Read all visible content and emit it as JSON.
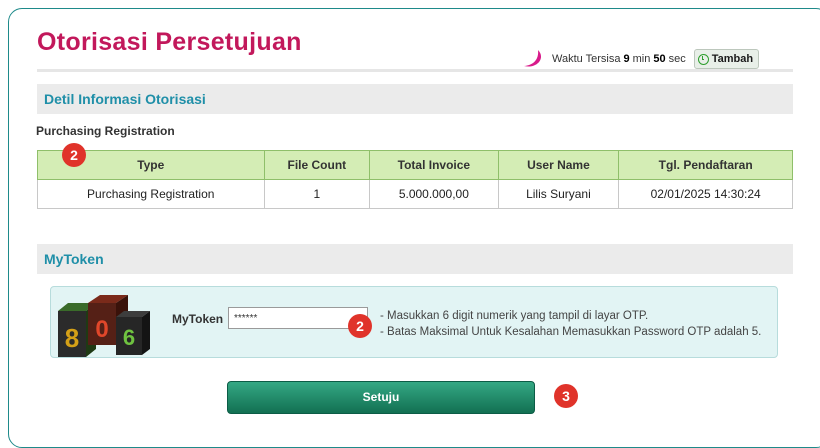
{
  "page": {
    "title": "Otorisasi Persetujuan"
  },
  "timer": {
    "label": "Waktu Tersisa",
    "minutes": "9",
    "min_label": "min",
    "seconds": "50",
    "sec_label": "sec",
    "add_button": "Tambah",
    "add_icon": "clock-icon",
    "accent_color": "#c2185b"
  },
  "detail": {
    "section_title": "Detil Informasi Otorisasi",
    "subtitle": "Purchasing Registration",
    "columns": [
      "Type",
      "File Count",
      "Total Invoice",
      "User Name",
      "Tgl. Pendaftaran"
    ],
    "rows": [
      [
        "Purchasing Registration",
        "1",
        "5.000.000,00",
        "Lilis Suryani",
        "02/01/2025 14:30:24"
      ]
    ]
  },
  "mytoken": {
    "section_title": "MyToken",
    "digits": [
      "8",
      "0",
      "6"
    ],
    "label": "MyToken",
    "value": "******",
    "notes": [
      "- Masukkan 6 digit numerik yang tampil di layar OTP.",
      "- Batas Maksimal Untuk Kesalahan Memasukkan Password OTP adalah 5."
    ]
  },
  "actions": {
    "submit_label": "Setuju"
  },
  "badges": {
    "table_badge": "2",
    "token_badge": "2",
    "submit_badge": "3",
    "color": "#e0332a"
  }
}
